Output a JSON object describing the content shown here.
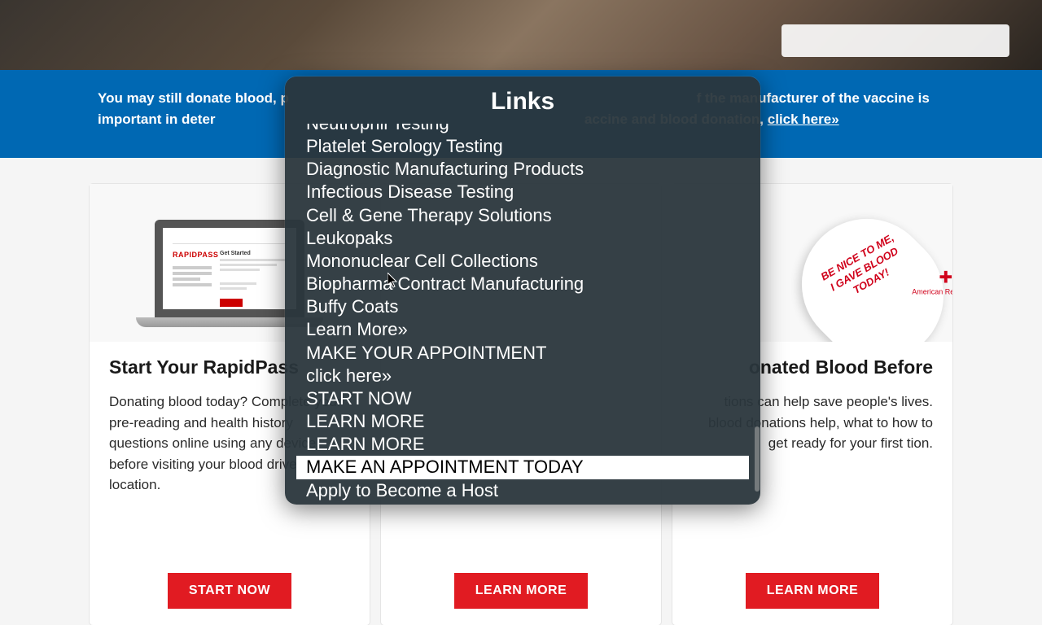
{
  "notice": {
    "text_prefix": "You may still donate blood, p",
    "text_middle": "f the manufacturer of the vaccine is important in deter",
    "text_suffix": "accine and blood donation, ",
    "link_label": "click here»"
  },
  "cards": [
    {
      "title": "Start Your RapidPass",
      "desc": "Donating blood today? Complete your pre-reading and health history questions online using any device, before visiting your blood drive location.",
      "btn": "START NOW",
      "rapid_label": "RAPIDPASS",
      "started_label": "Get Started"
    },
    {
      "title": "",
      "desc": "",
      "btn": "LEARN MORE"
    },
    {
      "title_suffix": "onated Blood Before",
      "desc": "tions can help save people's lives. blood donations help, what to how to get ready for your first tion.",
      "btn": "LEARN MORE",
      "heart_line1": "BE NICE TO ME,",
      "heart_line2": "I GAVE BLOOD",
      "heart_line3": "TODAY!",
      "arc_label": "American Red Cross"
    }
  ],
  "links_modal": {
    "title": "Links",
    "items": [
      "Neutrophil Testing",
      "Platelet Serology Testing",
      "Diagnostic Manufacturing Products",
      "Infectious Disease Testing",
      "Cell & Gene Therapy Solutions",
      "Leukopaks",
      "Mononuclear Cell Collections",
      "Biopharma Contract Manufacturing",
      "Buffy Coats",
      "Learn More»",
      "MAKE YOUR APPOINTMENT",
      "click here»",
      "START NOW",
      "LEARN MORE",
      "LEARN MORE",
      "MAKE AN APPOINTMENT TODAY",
      "Apply to Become a Host"
    ],
    "highlighted_index": 15
  }
}
